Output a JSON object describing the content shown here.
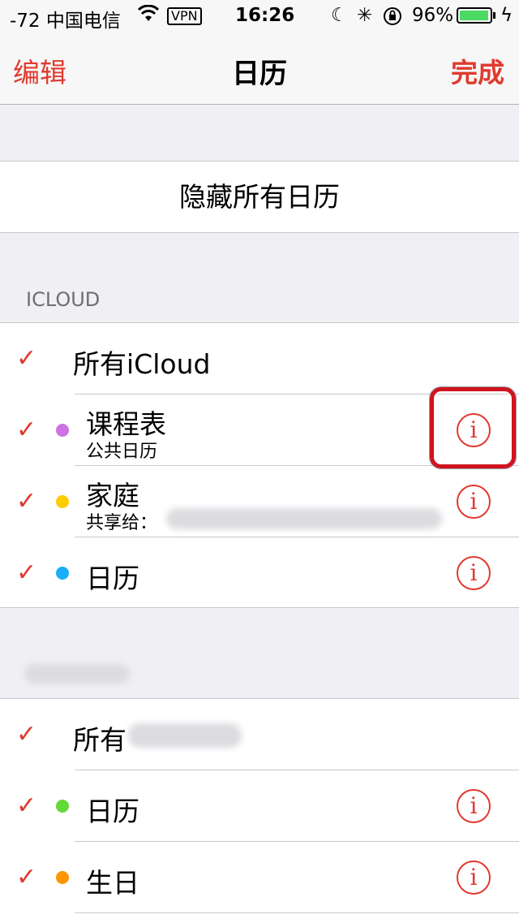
{
  "status_bar": {
    "carrier": "-72 中国电信",
    "wifi_icon": "wifi-icon",
    "vpn": "VPN",
    "time": "16:26",
    "moon_icon": "moon-icon",
    "activity_icon": "activity-spinner-icon",
    "rotation_lock_icon": "rotation-lock-icon",
    "battery_percent": "96%",
    "battery_level": 0.96,
    "charging_icon": "bolt-icon"
  },
  "nav": {
    "edit": "编辑",
    "title": "日历",
    "done": "完成"
  },
  "hide_all": "隐藏所有日历",
  "icloud_section": {
    "header": "ICLOUD",
    "all_label": "所有iCloud",
    "items": [
      {
        "title": "课程表",
        "subtitle": "公共日历",
        "color": "#cc73e1"
      },
      {
        "title": "家庭",
        "subtitle": "共享给：",
        "color": "#ffcc00"
      },
      {
        "title": "日历",
        "subtitle": "",
        "color": "#1badf8"
      }
    ]
  },
  "other_section": {
    "all_label": "所有",
    "items": [
      {
        "title": "日历",
        "color": "#63da38"
      },
      {
        "title": "生日",
        "color": "#ff9500"
      }
    ]
  },
  "info_symbol": "i",
  "check_symbol": "✓",
  "accent_color": "#e03a2f"
}
